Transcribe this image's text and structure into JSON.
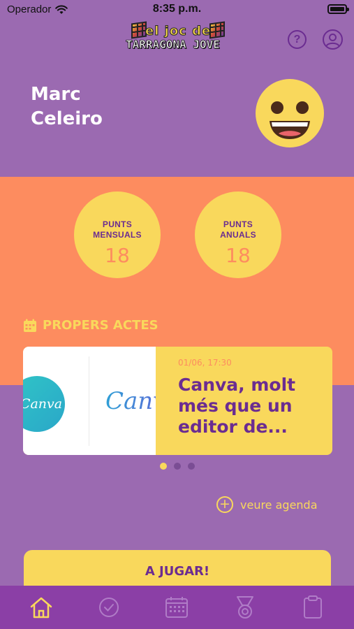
{
  "status_bar": {
    "carrier": "Operador",
    "time": "8:35 p.m."
  },
  "header": {
    "logo_line1": "el joc de",
    "logo_line2": "TARRAGONA JOVE",
    "help_label": "?"
  },
  "user": {
    "first_name": "Marc",
    "last_name": "Celeiro"
  },
  "points": {
    "monthly": {
      "label_line1": "PUNTS",
      "label_line2": "MENSUALS",
      "value": "18"
    },
    "yearly": {
      "label_line1": "PUNTS",
      "label_line2": "ANUALS",
      "value": "18"
    }
  },
  "upcoming": {
    "section_title": "PROPERS ACTES",
    "event": {
      "date": "01/06, 17:30",
      "title": "Canva, molt més que un editor de...",
      "image_logo_circle": "Canva",
      "image_logo_word": "Canva"
    },
    "carousel_pages": 3,
    "carousel_active": 0,
    "agenda_link": "veure agenda"
  },
  "play_button": "A JUGAR!",
  "tabs": [
    {
      "icon": "home-icon",
      "active": true
    },
    {
      "icon": "check-circle-icon",
      "active": false
    },
    {
      "icon": "calendar-icon",
      "active": false
    },
    {
      "icon": "medal-icon",
      "active": false
    },
    {
      "icon": "clipboard-icon",
      "active": false
    }
  ],
  "colors": {
    "purple": "#9b6ab1",
    "dark_purple": "#6b2c91",
    "orange": "#fd8c5f",
    "yellow": "#f9d85c",
    "tab_bar": "#8b3fa6"
  }
}
